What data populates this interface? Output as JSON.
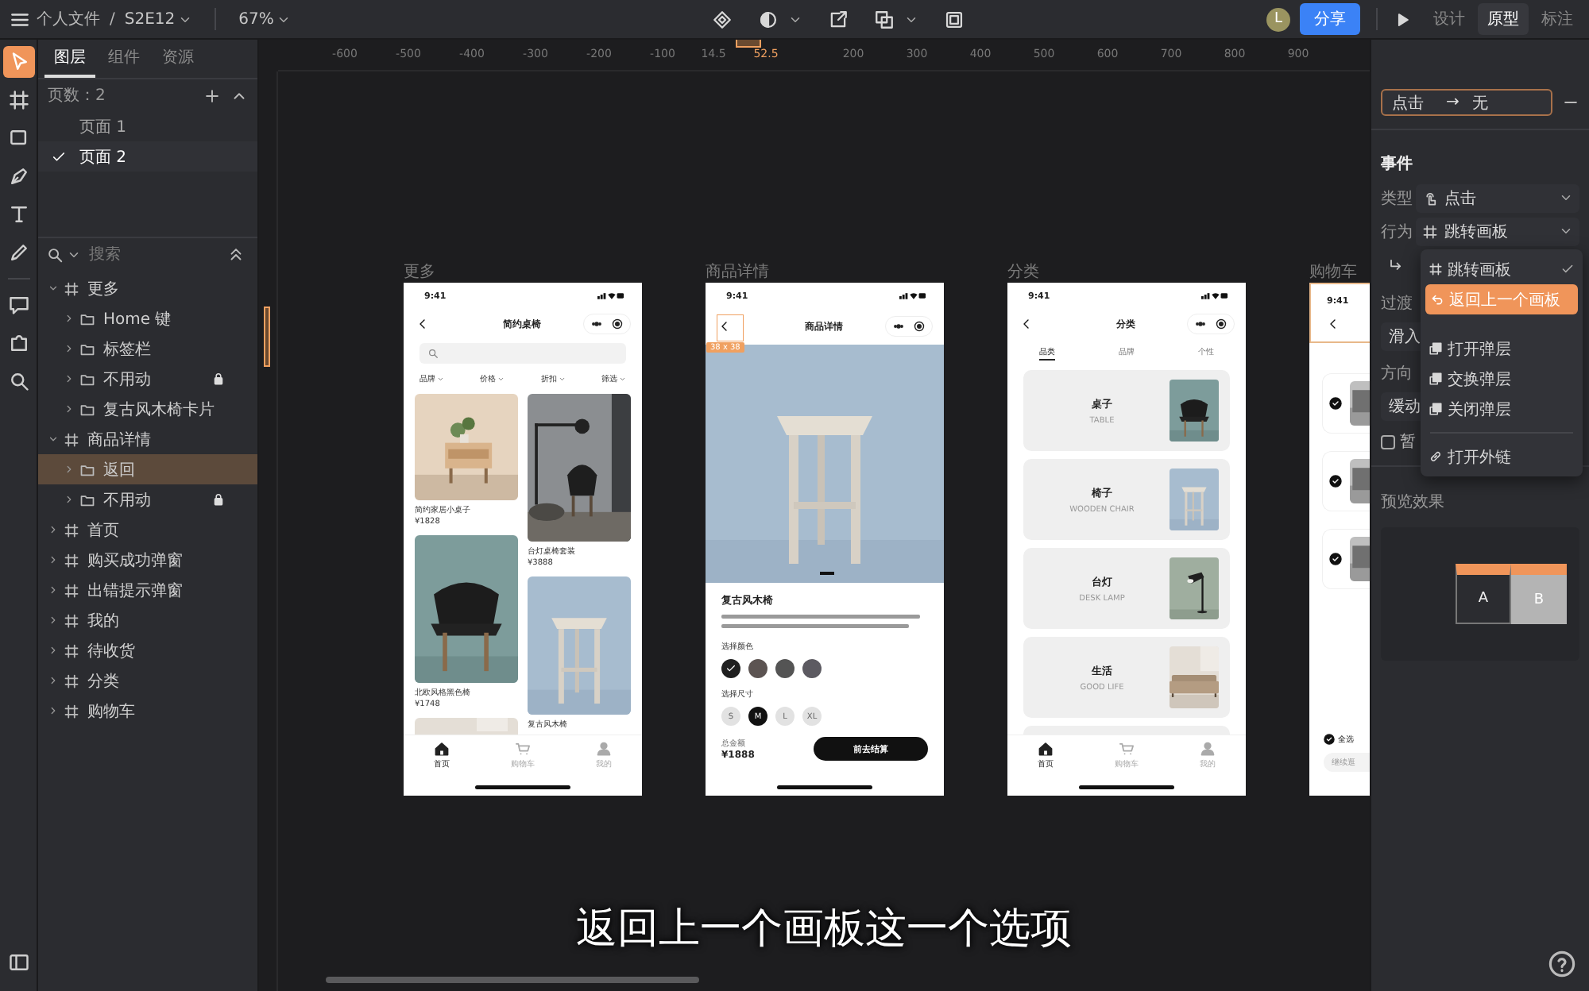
{
  "top_bar": {
    "folder": "个人文件",
    "separator": "/",
    "file": "S2E12",
    "zoom": "67%",
    "avatar": "L",
    "share_button": "分享",
    "mode_tabs": [
      {
        "label": "设计",
        "selected": false
      },
      {
        "label": "原型",
        "selected": true
      },
      {
        "label": "标注",
        "selected": false
      }
    ]
  },
  "toolbar": {
    "tools": [
      {
        "kind": "select",
        "selected": true
      },
      {
        "kind": "frame",
        "selected": false
      },
      {
        "kind": "rect",
        "selected": false
      },
      {
        "kind": "pen",
        "selected": false
      },
      {
        "kind": "text",
        "selected": false
      },
      {
        "kind": "pencil",
        "selected": false
      },
      {
        "kind": "comment",
        "selected": false
      },
      {
        "kind": "plugin",
        "selected": false
      },
      {
        "kind": "search",
        "selected": false
      }
    ]
  },
  "layers_panel": {
    "tabs": [
      {
        "label": "图层",
        "selected": true
      },
      {
        "label": "组件",
        "selected": false
      },
      {
        "label": "资源",
        "selected": false
      }
    ],
    "pages_header": "页数：2",
    "pages": [
      {
        "label": "页面 1",
        "selected": false
      },
      {
        "label": "页面 2",
        "selected": true
      }
    ],
    "search": {
      "placeholder": "搜索"
    },
    "layers": [
      {
        "label": "更多",
        "kind": "frame",
        "expanded": true,
        "locked": false,
        "selected": false,
        "children": [
          {
            "label": "Home 键",
            "kind": "folder",
            "expanded": false,
            "locked": false,
            "selected": false
          },
          {
            "label": "标签栏",
            "kind": "folder",
            "expanded": false,
            "locked": false,
            "selected": false
          },
          {
            "label": "不用动",
            "kind": "folder",
            "expanded": false,
            "locked": true,
            "selected": false
          },
          {
            "label": "复古风木椅卡片",
            "kind": "folder",
            "expanded": false,
            "locked": false,
            "selected": false
          }
        ]
      },
      {
        "label": "商品详情",
        "kind": "frame",
        "expanded": true,
        "locked": false,
        "selected": false,
        "children": [
          {
            "label": "返回",
            "kind": "folder",
            "expanded": false,
            "locked": false,
            "selected": true
          },
          {
            "label": "不用动",
            "kind": "folder",
            "expanded": false,
            "locked": true,
            "selected": false
          }
        ]
      },
      {
        "label": "首页",
        "kind": "frame",
        "expanded": false,
        "locked": false,
        "selected": false
      },
      {
        "label": "购买成功弹窗",
        "kind": "frame",
        "expanded": false,
        "locked": false,
        "selected": false
      },
      {
        "label": "出错提示弹窗",
        "kind": "frame",
        "expanded": false,
        "locked": false,
        "selected": false
      },
      {
        "label": "我的",
        "kind": "frame",
        "expanded": false,
        "locked": false,
        "selected": false
      },
      {
        "label": "待收货",
        "kind": "frame",
        "expanded": false,
        "locked": false,
        "selected": false
      },
      {
        "label": "分类",
        "kind": "frame",
        "expanded": false,
        "locked": false,
        "selected": false
      },
      {
        "label": "购物车",
        "kind": "frame",
        "expanded": false,
        "locked": false,
        "selected": false
      }
    ]
  },
  "canvas": {
    "ruler_ticks": [
      {
        "label": "-600",
        "highlighted": false
      },
      {
        "label": "-500",
        "highlighted": false
      },
      {
        "label": "-400",
        "highlighted": false
      },
      {
        "label": "-300",
        "highlighted": false
      },
      {
        "label": "-200",
        "highlighted": false
      },
      {
        "label": "-100",
        "highlighted": false
      },
      {
        "label": "14.5",
        "highlighted": false
      },
      {
        "label": "52.5",
        "highlighted": true
      },
      {
        "label": "200",
        "highlighted": false
      },
      {
        "label": "300",
        "highlighted": false
      },
      {
        "label": "400",
        "highlighted": false
      },
      {
        "label": "500",
        "highlighted": false
      },
      {
        "label": "600",
        "highlighted": false
      },
      {
        "label": "700",
        "highlighted": false
      },
      {
        "label": "800",
        "highlighted": false
      },
      {
        "label": "900",
        "highlighted": false
      }
    ],
    "artboards": [
      {
        "kind": "list",
        "name": "更多",
        "time": "9:41",
        "title": "简约桌椅",
        "filters": [
          "品牌",
          "价格",
          "折扣",
          "筛选"
        ],
        "products": [
          {
            "name": "简约家居小桌子",
            "price": "¥1828"
          },
          {
            "name": "台灯桌椅套装",
            "price": "¥3888"
          },
          {
            "name": "北欧风格黑色椅",
            "price": "¥1748"
          },
          {
            "name": "复古风木椅"
          },
          {
            "kind": "picture"
          }
        ],
        "tab_bar": [
          {
            "label": "首页",
            "selected": true
          },
          {
            "label": "购物车",
            "selected": false
          },
          {
            "label": "我的",
            "selected": false
          }
        ]
      },
      {
        "kind": "detail",
        "name": "商品详情",
        "time": "9:41",
        "title": "商品详情",
        "selection_badge": "38 x 38",
        "product": "复古风木椅",
        "color_label": "选择颜色",
        "colors": [
          {
            "color": "#1f1f1f",
            "selected": true
          },
          {
            "color": "#5c5452",
            "selected": false
          },
          {
            "color": "#545454",
            "selected": false
          },
          {
            "color": "#5c5a61",
            "selected": false
          }
        ],
        "size_label": "选择尺寸",
        "sizes": [
          {
            "label": "S",
            "selected": false
          },
          {
            "label": "M",
            "selected": true
          },
          {
            "label": "L",
            "selected": false
          },
          {
            "label": "XL",
            "selected": false
          }
        ],
        "total_label": "总金额",
        "total": "¥1888",
        "checkout_button": "前去结算"
      },
      {
        "kind": "category",
        "name": "分类",
        "time": "9:41",
        "title": "分类",
        "tabs": [
          {
            "label": "品类",
            "selected": true
          },
          {
            "label": "品牌",
            "selected": false
          },
          {
            "label": "个性",
            "selected": false
          }
        ],
        "categories": [
          {
            "name": "桌子",
            "subtitle": "TABLE"
          },
          {
            "name": "椅子",
            "subtitle": "WOODEN CHAIR"
          },
          {
            "name": "台灯",
            "subtitle": "DESK LAMP"
          },
          {
            "name": "生活",
            "subtitle": "GOOD LIFE"
          }
        ],
        "tab_bar": [
          {
            "label": "首页",
            "selected": true
          },
          {
            "label": "购物车",
            "selected": false
          },
          {
            "label": "我的",
            "selected": false
          }
        ]
      },
      {
        "kind": "cart",
        "name": "购物车",
        "time": "9:41",
        "header_highlighted": true,
        "select_all_checked": true,
        "select_all": "全选",
        "continue_button": "继续逛"
      }
    ],
    "subtitle": "返回上一个画板这一个选项"
  },
  "right_panel": {
    "interaction": {
      "trigger": "点击",
      "arrow": "→",
      "target": "无"
    },
    "event": {
      "title": "事件",
      "fields": [
        {
          "kind": "trigger",
          "label": "类型",
          "value": "点击"
        },
        {
          "kind": "action",
          "label": "行为",
          "value": "跳转画板"
        }
      ]
    },
    "action_menu": {
      "groups": [
        [
          {
            "kind": "frame",
            "label": "跳转画板",
            "checked": true,
            "highlighted": false
          },
          {
            "kind": "back",
            "label": "返回上一个画板",
            "checked": false,
            "highlighted": true
          }
        ],
        [
          {
            "kind": "open",
            "label": "打开弹层",
            "checked": false,
            "highlighted": false
          },
          {
            "kind": "swap",
            "label": "交换弹层",
            "checked": false,
            "highlighted": false
          },
          {
            "kind": "close",
            "label": "关闭弹层",
            "checked": false,
            "highlighted": false
          }
        ],
        [
          {
            "kind": "link",
            "label": "打开外链",
            "checked": false,
            "highlighted": false
          }
        ]
      ]
    },
    "transition": {
      "title": "过渡",
      "effect": "滑入",
      "direction_label": "方向",
      "easing": "缓动",
      "checkbox": {
        "label": "暂",
        "checked": false
      }
    },
    "preview": {
      "title": "预览效果",
      "from": "A",
      "to": "B"
    }
  }
}
